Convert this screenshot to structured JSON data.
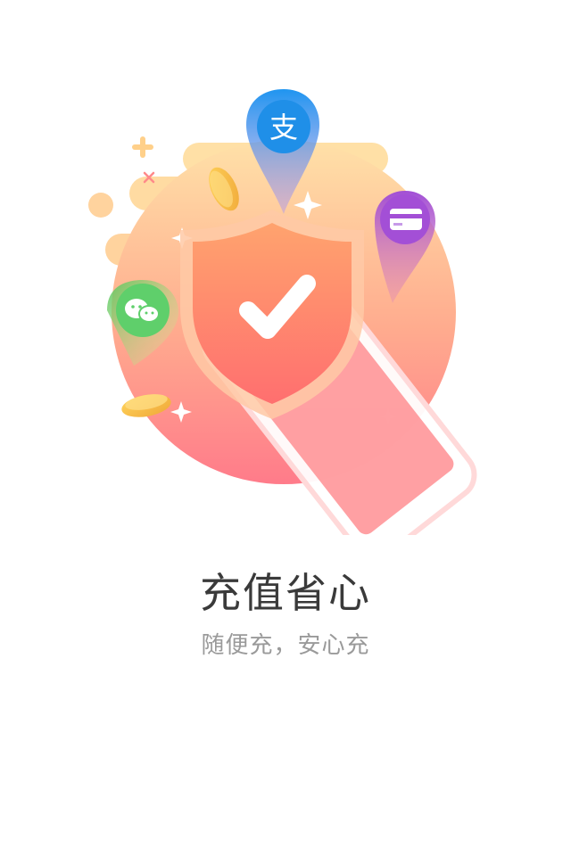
{
  "onboarding": {
    "title": "充值省心",
    "subtitle": "随便充，安心充",
    "illustration": {
      "icons": [
        "alipay-icon",
        "wechat-icon",
        "card-icon",
        "shield-check-icon",
        "phone-icon",
        "coin-icon"
      ],
      "colors": {
        "circle_top": "#ffd29a",
        "circle_bottom": "#ff7b8a",
        "shield": "#ff8a6a",
        "alipay": "#2d9cf0",
        "wechat": "#5fcf6b",
        "card": "#a45ad8",
        "coin": "#f6c64a"
      }
    }
  }
}
